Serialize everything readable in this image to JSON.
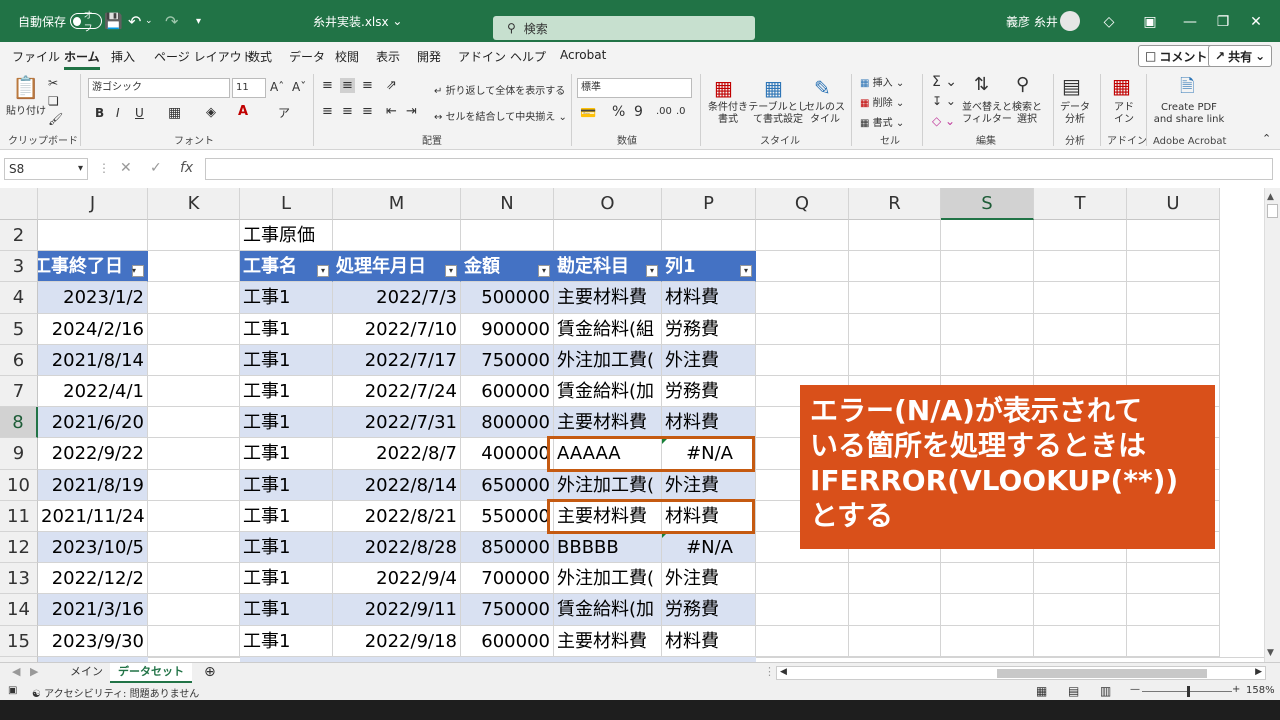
{
  "titlebar": {
    "autosave_label": "自動保存",
    "autosave_state": "オフ",
    "filename": "糸井実装.xlsx",
    "search_placeholder": "検索",
    "user_name": "義彦 糸井"
  },
  "menu": {
    "tabs": [
      "ファイル",
      "ホーム",
      "挿入",
      "ページ レイアウト",
      "数式",
      "データ",
      "校閲",
      "表示",
      "開発",
      "アドイン",
      "ヘルプ",
      "Acrobat"
    ],
    "active": "ホーム",
    "comment_btn": "コメント",
    "share_btn": "共有"
  },
  "ribbon": {
    "clipboard": {
      "paste": "貼り付け",
      "label": "クリップボード"
    },
    "font": {
      "name": "游ゴシック",
      "size": "11",
      "label": "フォント",
      "bold": "B",
      "italic": "I",
      "underline": "U"
    },
    "alignment": {
      "wrap": "折り返して全体を表示する",
      "merge": "セルを結合して中央揃え",
      "label": "配置"
    },
    "number": {
      "format": "標準",
      "label": "数値"
    },
    "styles": {
      "conditional": "条件付き書式",
      "table": "テーブルとして書式設定",
      "cell": "セルのスタイル",
      "label": "スタイル"
    },
    "cells": {
      "insert": "挿入",
      "delete": "削除",
      "format": "書式",
      "label": "セル"
    },
    "editing": {
      "sort": "並べ替えとフィルター",
      "find": "検索と選択",
      "label": "編集"
    },
    "analysis": {
      "data": "データ分析",
      "label": "分析"
    },
    "addins": {
      "addin": "アドイン",
      "label": "アドイン"
    },
    "acrobat": {
      "create": "Create PDF and share link",
      "label": "Adobe Acrobat"
    }
  },
  "formula": {
    "name_box": "S8",
    "content": ""
  },
  "columns": [
    "J",
    "K",
    "L",
    "M",
    "N",
    "O",
    "P",
    "Q",
    "R",
    "S",
    "T",
    "U"
  ],
  "selected_column": "S",
  "rows": [
    "2",
    "3",
    "4",
    "5",
    "6",
    "7",
    "8",
    "9",
    "10",
    "11",
    "12",
    "13",
    "14",
    "15"
  ],
  "selected_row": "8",
  "title_cell": "工事原価",
  "j_header": "工事終了日",
  "headers": [
    "工事名",
    "処理年月日",
    "金額",
    "勘定科目",
    "列1"
  ],
  "j_values": [
    "2023/1/2",
    "2024/2/16",
    "2021/8/14",
    "2022/4/1",
    "2021/6/20",
    "2022/9/22",
    "2021/8/19",
    "2021/11/24",
    "2023/10/5",
    "2022/12/2",
    "2021/3/16",
    "2023/9/30"
  ],
  "table_rows": [
    [
      "工事1",
      "2022/7/3",
      "500000",
      "主要材料費",
      "材料費"
    ],
    [
      "工事1",
      "2022/7/10",
      "900000",
      "賃金給料(組",
      "労務費"
    ],
    [
      "工事1",
      "2022/7/17",
      "750000",
      "外注加工費(",
      "外注費"
    ],
    [
      "工事1",
      "2022/7/24",
      "600000",
      "賃金給料(加",
      "労務費"
    ],
    [
      "工事1",
      "2022/7/31",
      "800000",
      "主要材料費",
      "材料費"
    ],
    [
      "工事1",
      "2022/8/7",
      "400000",
      "AAAAA",
      "#N/A"
    ],
    [
      "工事1",
      "2022/8/14",
      "650000",
      "外注加工費(",
      "外注費"
    ],
    [
      "工事1",
      "2022/8/21",
      "550000",
      "主要材料費",
      "材料費"
    ],
    [
      "工事1",
      "2022/8/28",
      "850000",
      "BBBBB",
      "#N/A"
    ],
    [
      "工事1",
      "2022/9/4",
      "700000",
      "外注加工費(",
      "外注費"
    ],
    [
      "工事1",
      "2022/9/11",
      "750000",
      "賃金給料(加",
      "労務費"
    ],
    [
      "工事1",
      "2022/9/18",
      "600000",
      "主要材料費",
      "材料費"
    ]
  ],
  "callout_lines": [
    "エラー(N/A)が表示されて",
    "いる箇所を処理するときは",
    "IFERROR(VLOOKUP(**))",
    "とする"
  ],
  "sheets": [
    "メイン",
    "データセット"
  ],
  "active_sheet": "データセット",
  "status": {
    "accessibility": "アクセシビリティ: 問題ありません",
    "zoom": "158%"
  },
  "colors": {
    "accent": "#217346",
    "table_header": "#4472c4",
    "band": "#d9e1f2",
    "callout": "#d9501a"
  }
}
